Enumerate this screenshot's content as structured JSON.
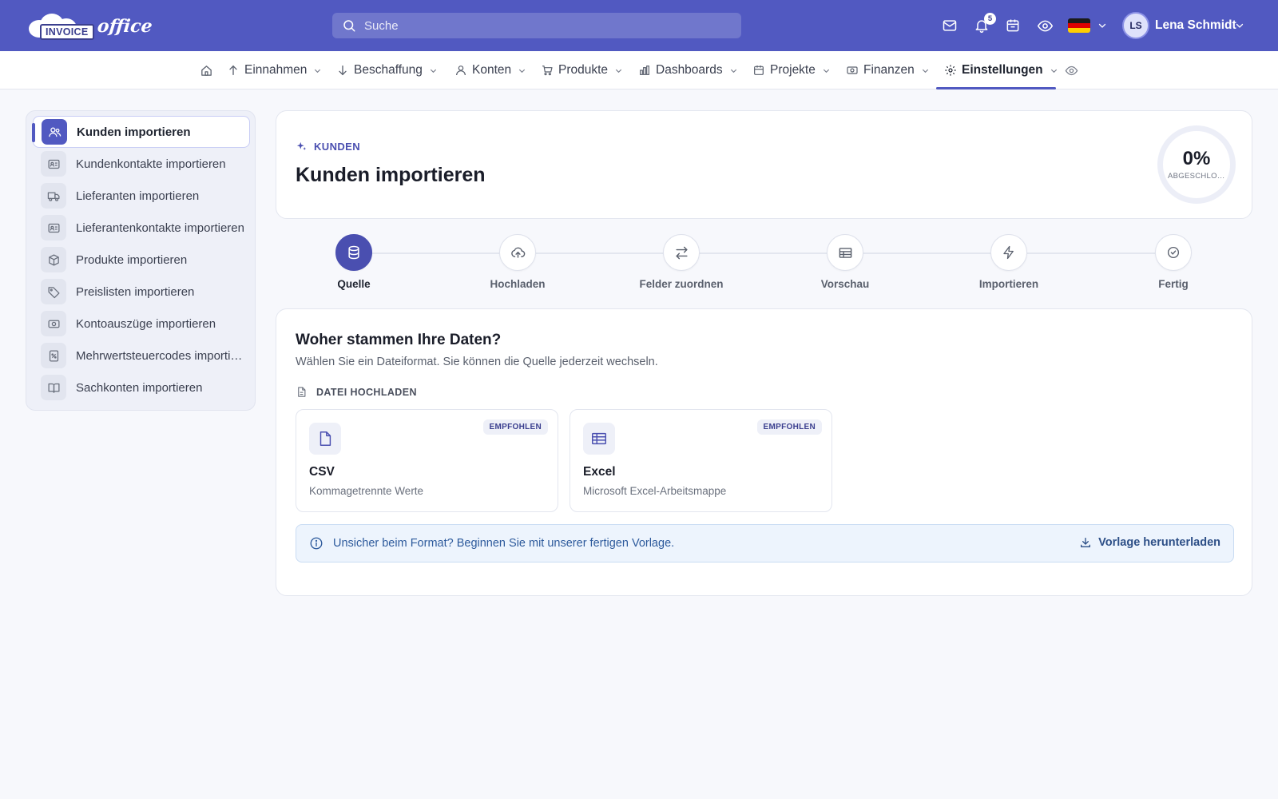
{
  "app": {
    "logo_badge": "INVOICE",
    "logo_script": "office"
  },
  "topbar": {
    "search_placeholder": "Suche",
    "notification_count": "5",
    "avatar_initials": "LS",
    "user_name": "Lena Schmidt",
    "accent_color": "#5159c1"
  },
  "nav": {
    "items": [
      {
        "label": "Einnahmen",
        "icon": "arrow-up-icon"
      },
      {
        "label": "Beschaffung",
        "icon": "arrow-down-icon"
      },
      {
        "label": "Konten",
        "icon": "user-icon"
      },
      {
        "label": "Produkte",
        "icon": "cart-icon"
      },
      {
        "label": "Dashboards",
        "icon": "bar-chart-icon"
      },
      {
        "label": "Projekte",
        "icon": "calendar-icon"
      },
      {
        "label": "Finanzen",
        "icon": "money-icon"
      },
      {
        "label": "Einstellungen",
        "icon": "gear-icon",
        "active": true
      }
    ]
  },
  "sidebar": {
    "items": [
      {
        "label": "Kunden importieren",
        "icon": "users-icon",
        "active": true
      },
      {
        "label": "Kundenkontakte importieren",
        "icon": "contact-card-icon"
      },
      {
        "label": "Lieferanten importieren",
        "icon": "truck-icon"
      },
      {
        "label": "Lieferantenkontakte importieren",
        "icon": "contact-card-icon"
      },
      {
        "label": "Produkte importieren",
        "icon": "box-icon"
      },
      {
        "label": "Preislisten importieren",
        "icon": "tag-icon"
      },
      {
        "label": "Kontoauszüge importieren",
        "icon": "banknote-icon"
      },
      {
        "label": "Mehrwertsteuercodes importieren",
        "icon": "percent-file-icon"
      },
      {
        "label": "Sachkonten importieren",
        "icon": "book-icon"
      }
    ]
  },
  "header": {
    "crumb": "KUNDEN",
    "title": "Kunden importieren",
    "progress_percent": "0%",
    "progress_label": "ABGESCHLOSSEN"
  },
  "stepper": {
    "steps": [
      {
        "label": "Quelle",
        "icon": "database-icon",
        "active": true
      },
      {
        "label": "Hochladen",
        "icon": "cloud-upload-icon"
      },
      {
        "label": "Felder zuordnen",
        "icon": "swap-icon"
      },
      {
        "label": "Vorschau",
        "icon": "table-icon"
      },
      {
        "label": "Importieren",
        "icon": "lightning-icon"
      },
      {
        "label": "Fertig",
        "icon": "check-circle-icon"
      }
    ]
  },
  "main": {
    "title": "Woher stammen Ihre Daten?",
    "subtitle": "Wählen Sie ein Dateiformat. Sie können die Quelle jederzeit wechseln.",
    "section_label": "DATEI HOCHLADEN",
    "options": [
      {
        "title": "CSV",
        "description": "Kommagetrennte Werte",
        "badge": "EMPFOHLEN",
        "icon": "file-icon"
      },
      {
        "title": "Excel",
        "description": "Microsoft Excel-Arbeitsmappe",
        "badge": "EMPFOHLEN",
        "icon": "spreadsheet-icon"
      }
    ],
    "info_text": "Unsicher beim Format? Beginnen Sie mit unserer fertigen Vorlage.",
    "download_label": "Vorlage herunterladen"
  }
}
